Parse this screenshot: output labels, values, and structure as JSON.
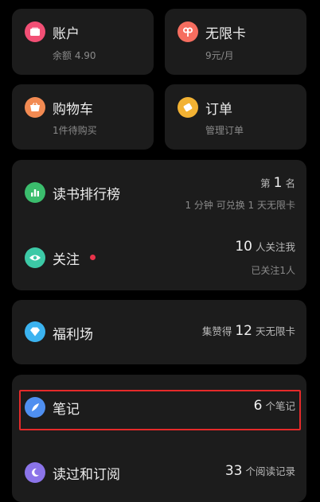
{
  "colors": {
    "account": "#f24f75",
    "unlimited": "#f66d5f",
    "cart": "#f28a52",
    "orders": "#f2b233",
    "ranking": "#3bbd6d",
    "follow": "#3cc9a6",
    "welfare": "#3bb3f0",
    "notes": "#4f8ff0",
    "history": "#8b74e9",
    "red_dot": "#e8334a",
    "highlight_border": "#e52a2a"
  },
  "icons": {
    "account": "wallet-icon",
    "unlimited": "pretzel-icon",
    "cart": "basket-icon",
    "orders": "ticket-icon",
    "ranking": "bar-chart-icon",
    "follow": "eye-icon",
    "welfare": "diamond-icon",
    "notes": "feather-icon",
    "history": "moon-icon"
  },
  "account": {
    "title": "账户",
    "sub": "余额 4.90"
  },
  "unlimited": {
    "title": "无限卡",
    "sub": "9元/月"
  },
  "cart": {
    "title": "购物车",
    "sub": "1件待购买"
  },
  "orders": {
    "title": "订单",
    "sub": "管理订单"
  },
  "ranking": {
    "title": "读书排行榜",
    "rank_prefix": "第",
    "rank_value": "1",
    "rank_suffix": "名",
    "detail": "1 分钟 可兑换 1 天无限卡"
  },
  "follow": {
    "title": "关注",
    "count": "10",
    "count_suffix": "人关注我",
    "following": "已关注1人"
  },
  "welfare": {
    "title": "福利场",
    "prefix": "集赞得",
    "value": "12",
    "suffix": "天无限卡"
  },
  "notes": {
    "title": "笔记",
    "value": "6",
    "suffix": "个笔记"
  },
  "history": {
    "title": "读过和订阅",
    "value": "33",
    "suffix": "个阅读记录"
  }
}
